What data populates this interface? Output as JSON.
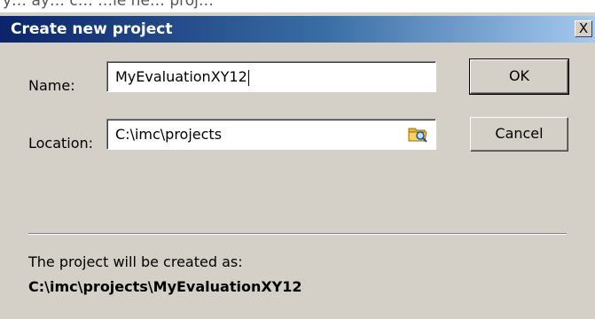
{
  "window": {
    "title": "Create new project",
    "close_label": "X",
    "background_partial_text": "y… ay… c… …ie ne… proj…"
  },
  "form": {
    "name_label": "Name:",
    "name_value": "MyEvaluationXY12",
    "location_label": "Location:",
    "location_value": "C:\\imc\\projects",
    "browse_icon": "folder-browse-icon"
  },
  "buttons": {
    "ok_label": "OK",
    "cancel_label": "Cancel"
  },
  "result": {
    "caption": "The project will be created as:",
    "path": "C:\\imc\\projects\\MyEvaluationXY12"
  },
  "colors": {
    "title_gradient_start": "#0a246a",
    "title_gradient_end": "#a6caf0",
    "dialog_face": "#d4d0c8"
  }
}
